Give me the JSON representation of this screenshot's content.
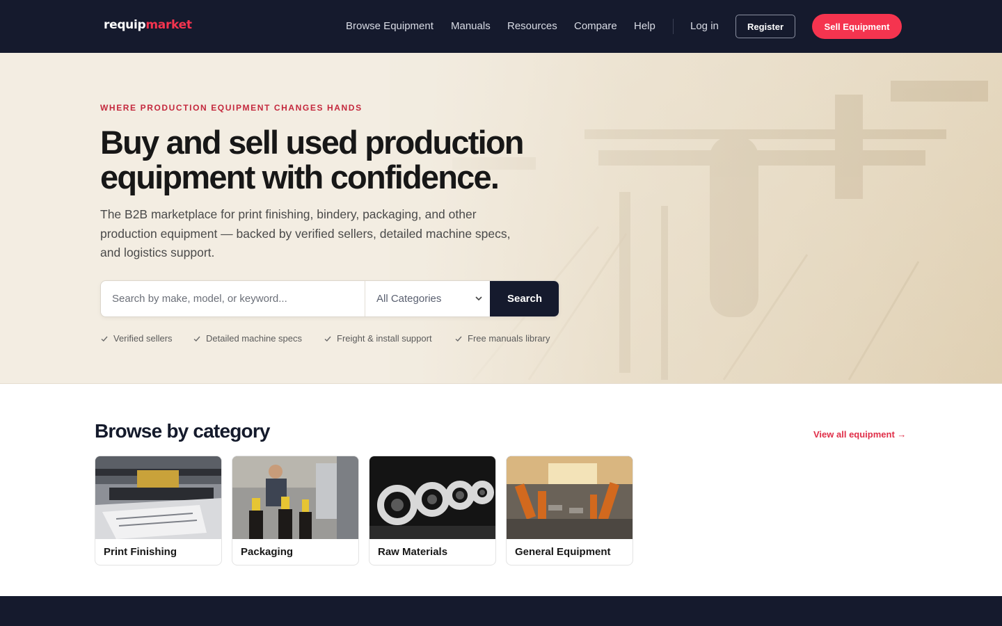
{
  "nav": {
    "logo_part1": "requip",
    "logo_part2": "market",
    "links": [
      "Browse Equipment",
      "Manuals",
      "Resources",
      "Compare",
      "Help"
    ],
    "login": "Log in",
    "register": "Register",
    "sell": "Sell Equipment"
  },
  "hero": {
    "eyebrow": "WHERE PRODUCTION EQUIPMENT CHANGES HANDS",
    "headline": "Buy and sell used production equipment with confidence.",
    "subhead": "The B2B marketplace for print finishing, bindery, packaging, and other production equipment — backed by verified sellers, detailed machine specs, and logistics support.",
    "search_placeholder": "Search by make, model, or keyword...",
    "category_selected": "All Categories",
    "search_button": "Search",
    "features": [
      "Verified sellers",
      "Detailed machine specs",
      "Freight & install support",
      "Free manuals library"
    ]
  },
  "categories": {
    "title": "Browse by category",
    "view_all": "View all equipment →",
    "items": [
      {
        "label": "Print Finishing",
        "icon": "print-finishing-photo"
      },
      {
        "label": "Packaging",
        "icon": "packaging-photo"
      },
      {
        "label": "Raw Materials",
        "icon": "raw-materials-photo"
      },
      {
        "label": "General Equipment",
        "icon": "general-equipment-photo"
      }
    ]
  },
  "colors": {
    "navy": "#151a2d",
    "accent_red": "#f5344f",
    "eyebrow_red": "#c4283d",
    "hero_bg": "#f2ece1"
  }
}
